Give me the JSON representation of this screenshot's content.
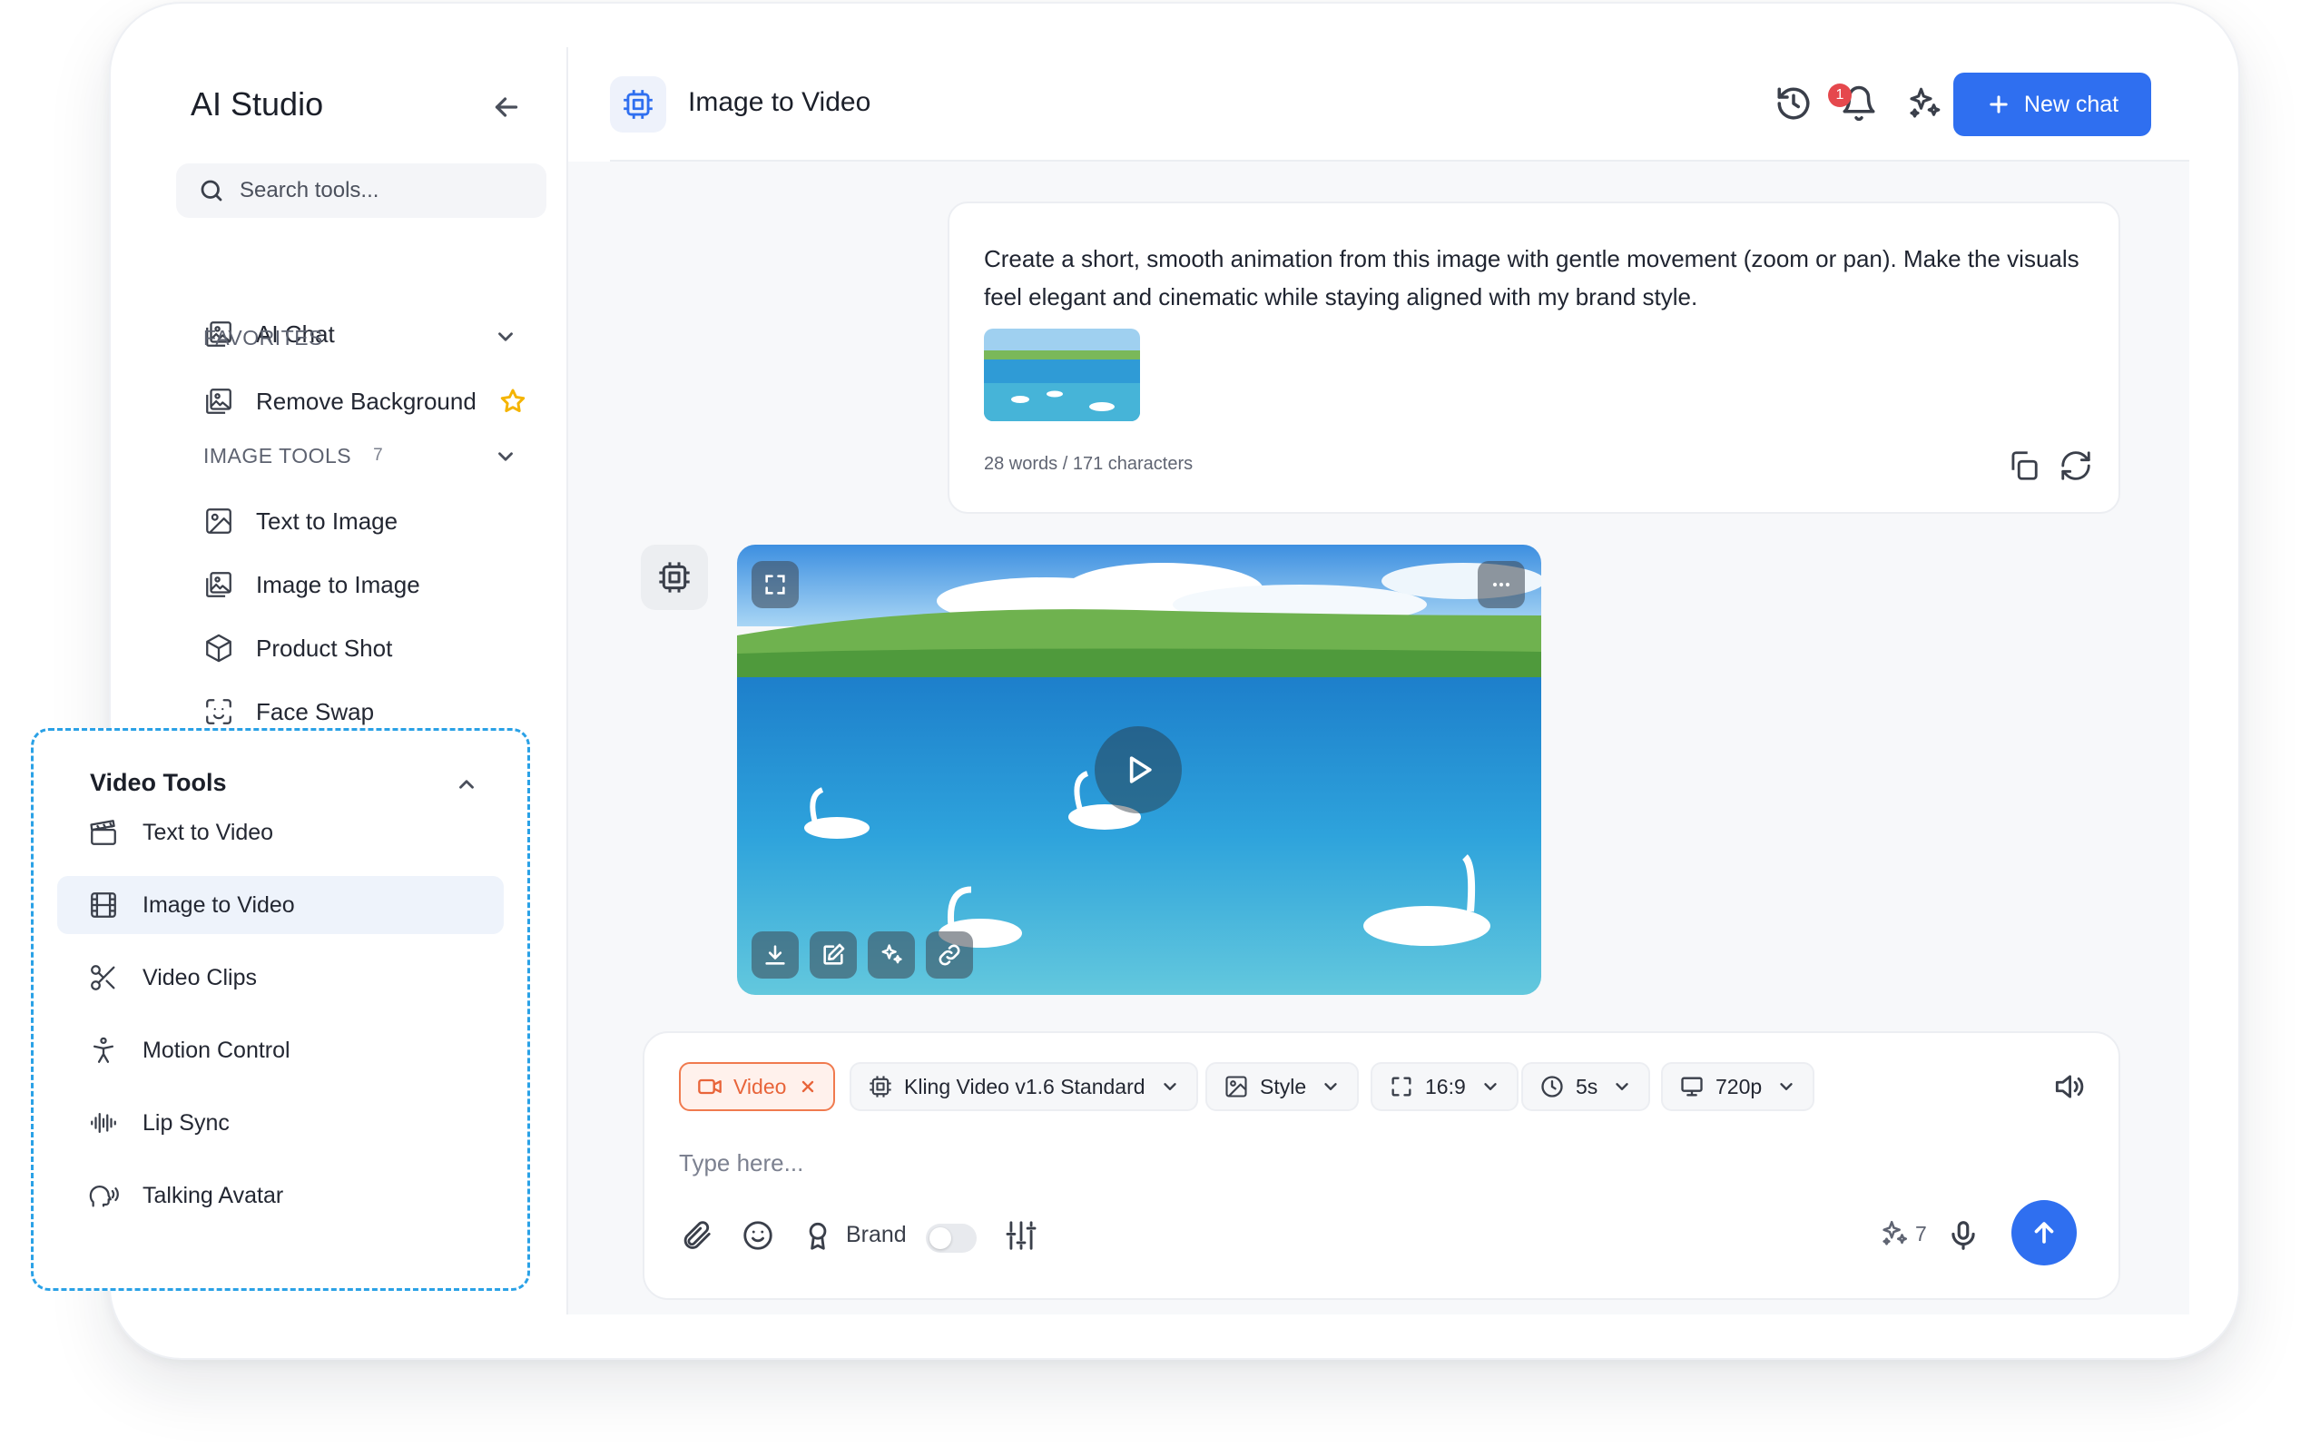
{
  "sidebar": {
    "app_title": "AI Studio",
    "search_placeholder": "Search tools...",
    "ai_chat": "AI Chat",
    "favorites_label": "FAVORITES",
    "favorites": [
      "Remove Background"
    ],
    "image_tools_label": "IMAGE TOOLS",
    "image_tools_count": "7",
    "image_tools": [
      "Text to Image",
      "Image to Image",
      "Product Shot",
      "Face Swap"
    ],
    "video_tools_label": "Video Tools",
    "video_tools": [
      "Text to Video",
      "Image to Video",
      "Video Clips",
      "Motion Control",
      "Lip Sync",
      "Talking Avatar"
    ],
    "active_item": "Image to Video"
  },
  "header": {
    "title": "Image to Video",
    "notification_count": "1",
    "new_chat_label": "New chat"
  },
  "message": {
    "text": "Create a short, smooth animation from this image with gentle movement (zoom or pan). Make the visuals feel elegant and cinematic while staying aligned with my brand style.",
    "meta": "28 words / 171 characters"
  },
  "composer": {
    "mode_chip": "Video",
    "model": "Kling Video v1.6 Standard",
    "style": "Style",
    "aspect": "16:9",
    "duration": "5s",
    "resolution": "720p",
    "placeholder": "Type here...",
    "brand_label": "Brand",
    "credits": "7"
  },
  "colors": {
    "accent": "#2f6ff0",
    "panel_dash": "#2aa1e6",
    "video_chip": "#e8643a",
    "badge": "#e5484d",
    "star": "#f5b400"
  }
}
